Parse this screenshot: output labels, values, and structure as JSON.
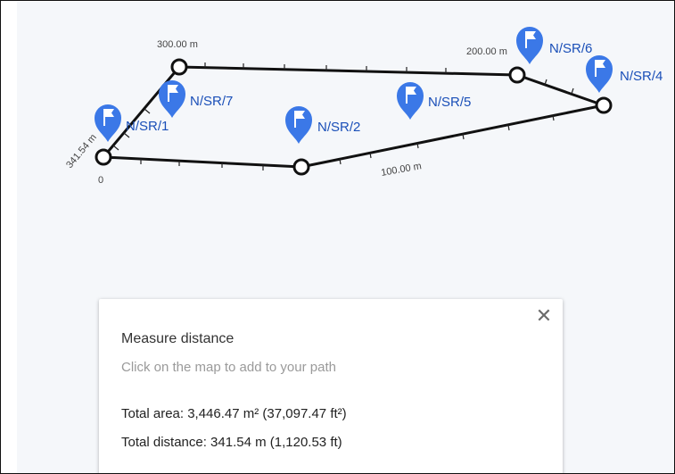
{
  "map": {
    "pins": [
      {
        "label": "N/SR/1"
      },
      {
        "label": "N/SR/7"
      },
      {
        "label": "N/SR/2"
      },
      {
        "label": "N/SR/5"
      },
      {
        "label": "N/SR/6"
      },
      {
        "label": "N/SR/4"
      }
    ],
    "distance_labels": {
      "start": "0",
      "d100": "100.00 m",
      "d200": "200.00 m",
      "d300": "300.00 m",
      "end": "341.54 m"
    },
    "colors": {
      "pin": "#3b78e7",
      "path": "#111111"
    }
  },
  "panel": {
    "title": "Measure distance",
    "hint": "Click on the map to add to your path",
    "total_area": "Total area: 3,446.47 m² (37,097.47 ft²)",
    "total_distance": "Total distance: 341.54 m (1,120.53 ft)",
    "close_symbol": "✕"
  }
}
